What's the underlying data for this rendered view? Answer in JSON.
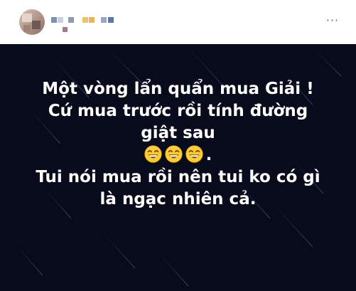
{
  "post": {
    "header": {
      "more_icon": "more-horizontal-icon",
      "more_label": "···"
    },
    "content": {
      "background_color": "#070b1b",
      "text_color": "#ffffff",
      "line1": "Một vòng lẩn quẩn mua Giải !",
      "line2": "Cứ mua trước rồi tính đường",
      "line3": "giật sau",
      "emoji_count": 3,
      "emoji_icon": "grinning-face-with-smiling-eyes-icon",
      "emoji_suffix": ".",
      "line5": "Tui nói mua rồi nên tui ko có gì",
      "line6": "là ngạc nhiên cả."
    }
  }
}
